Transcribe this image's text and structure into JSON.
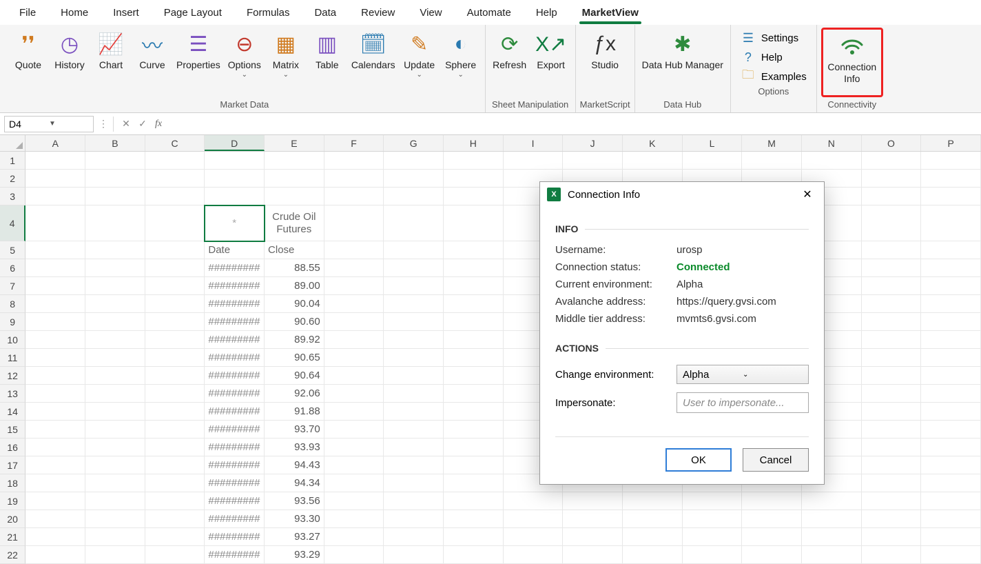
{
  "tabs": [
    "File",
    "Home",
    "Insert",
    "Page Layout",
    "Formulas",
    "Data",
    "Review",
    "View",
    "Automate",
    "Help",
    "MarketView"
  ],
  "active_tab_index": 10,
  "ribbon": {
    "groups": [
      {
        "label": "Market Data",
        "buttons": [
          {
            "name": "quote",
            "label": "Quote",
            "glyph": "❜❜",
            "color": "#d07a1e",
            "caret": false
          },
          {
            "name": "history",
            "label": "History",
            "glyph": "◷",
            "color": "#7a4fbf",
            "caret": false
          },
          {
            "name": "chart",
            "label": "Chart",
            "glyph": "📈",
            "color": "#2a7ab0",
            "caret": false
          },
          {
            "name": "curve",
            "label": "Curve",
            "glyph": "〰",
            "color": "#2a7ab0",
            "caret": false
          },
          {
            "name": "properties",
            "label": "Properties",
            "glyph": "☰",
            "color": "#7a4fbf",
            "caret": false
          },
          {
            "name": "options",
            "label": "Options",
            "glyph": "⊖",
            "color": "#c23a2e",
            "caret": true
          },
          {
            "name": "matrix",
            "label": "Matrix",
            "glyph": "▦",
            "color": "#d07a1e",
            "caret": true
          },
          {
            "name": "table",
            "label": "Table",
            "glyph": "▥",
            "color": "#7a4fbf",
            "caret": false
          },
          {
            "name": "calendars",
            "label": "Calendars",
            "glyph": "🗓",
            "color": "#2a7ab0",
            "caret": false
          },
          {
            "name": "update",
            "label": "Update",
            "glyph": "✎",
            "color": "#d07a1e",
            "caret": true
          },
          {
            "name": "sphere",
            "label": "Sphere",
            "glyph": "◐",
            "color": "#2a7ab0",
            "caret": true
          }
        ]
      },
      {
        "label": "Sheet Manipulation",
        "buttons": [
          {
            "name": "refresh",
            "label": "Refresh",
            "glyph": "⟳",
            "color": "#2e8b3d",
            "caret": false
          },
          {
            "name": "export",
            "label": "Export",
            "glyph": "X↗",
            "color": "#107c41",
            "caret": false
          }
        ]
      },
      {
        "label": "MarketScript",
        "buttons": [
          {
            "name": "studio",
            "label": "Studio",
            "glyph": "ƒx",
            "color": "#333",
            "caret": false
          }
        ]
      },
      {
        "label": "Data Hub",
        "buttons": [
          {
            "name": "datahub",
            "label": "Data Hub Manager",
            "glyph": "✱",
            "color": "#2e8b3d",
            "caret": false
          }
        ]
      }
    ],
    "options_group": {
      "label": "Options",
      "items": [
        {
          "name": "settings",
          "label": "Settings",
          "glyph": "☰",
          "color": "#2a7ab0"
        },
        {
          "name": "help",
          "label": "Help",
          "glyph": "?",
          "color": "#2a7ab0"
        },
        {
          "name": "examples",
          "label": "Examples",
          "glyph": "🗀",
          "color": "#d9a23a"
        }
      ]
    },
    "connectivity": {
      "label": "Connectivity",
      "button": {
        "name": "connection-info",
        "label_line1": "Connection",
        "label_line2": "Info",
        "glyph": "⎋",
        "color": "#2e8b3d"
      }
    }
  },
  "namebox": "D4",
  "columns": [
    "A",
    "B",
    "C",
    "D",
    "E",
    "F",
    "G",
    "H",
    "I",
    "J",
    "K",
    "L",
    "M",
    "N",
    "O",
    "P"
  ],
  "active_col_index": 3,
  "active_row_index": 3,
  "sheet": {
    "header_title_line1": "Crude Oil",
    "header_title_line2": "Futures",
    "col_d_header": "Date",
    "col_e_header": "Close",
    "asterisk": "*",
    "rows": [
      {
        "d": "#########",
        "e": "88.55"
      },
      {
        "d": "#########",
        "e": "89.00"
      },
      {
        "d": "#########",
        "e": "90.04"
      },
      {
        "d": "#########",
        "e": "90.60"
      },
      {
        "d": "#########",
        "e": "89.92"
      },
      {
        "d": "#########",
        "e": "90.65"
      },
      {
        "d": "#########",
        "e": "90.64"
      },
      {
        "d": "#########",
        "e": "92.06"
      },
      {
        "d": "#########",
        "e": "91.88"
      },
      {
        "d": "#########",
        "e": "93.70"
      },
      {
        "d": "#########",
        "e": "93.93"
      },
      {
        "d": "#########",
        "e": "94.43"
      },
      {
        "d": "#########",
        "e": "94.34"
      },
      {
        "d": "#########",
        "e": "93.56"
      },
      {
        "d": "#########",
        "e": "93.30"
      },
      {
        "d": "#########",
        "e": "93.27"
      },
      {
        "d": "#########",
        "e": "93.29"
      }
    ]
  },
  "dialog": {
    "title": "Connection Info",
    "info_heading": "INFO",
    "actions_heading": "ACTIONS",
    "rows": [
      {
        "k": "Username:",
        "v": "urosp",
        "cls": ""
      },
      {
        "k": "Connection status:",
        "v": "Connected",
        "cls": "connected"
      },
      {
        "k": "Current environment:",
        "v": "Alpha",
        "cls": ""
      },
      {
        "k": "Avalanche address:",
        "v": "https://query.gvsi.com",
        "cls": ""
      },
      {
        "k": "Middle tier address:",
        "v": "mvmts6.gvsi.com",
        "cls": ""
      }
    ],
    "change_env_label": "Change environment:",
    "change_env_value": "Alpha",
    "impersonate_label": "Impersonate:",
    "impersonate_placeholder": "User to impersonate...",
    "ok": "OK",
    "cancel": "Cancel"
  }
}
